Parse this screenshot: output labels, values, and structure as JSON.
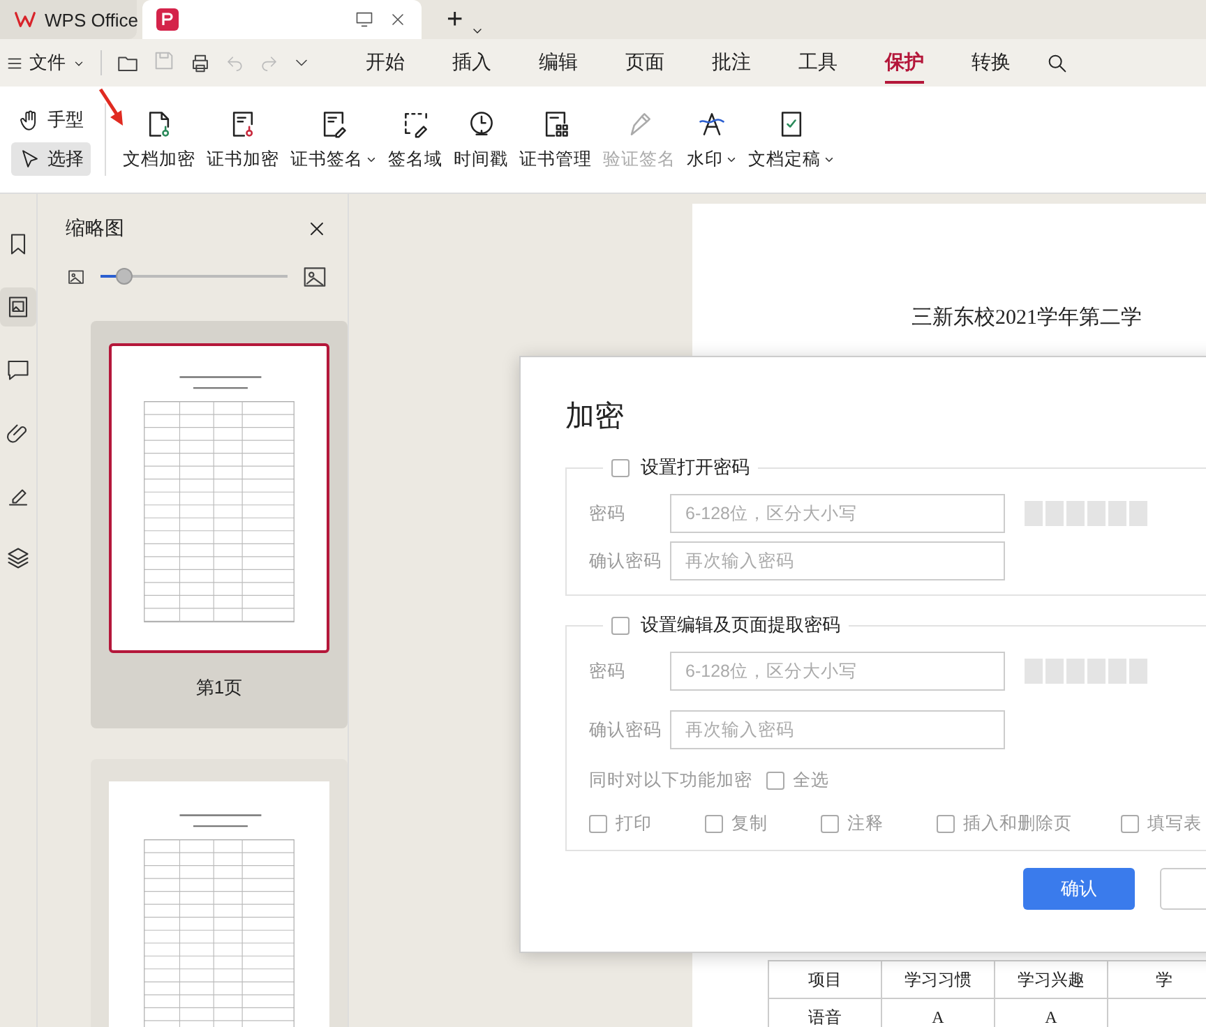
{
  "title_tabs": [
    {
      "kind": "home",
      "title": "WPS Office",
      "selected": false
    },
    {
      "kind": "pdf",
      "selected": true
    }
  ],
  "new_tab": "+",
  "menu": {
    "file": "文件",
    "ribbon_tabs": [
      {
        "label": "开始",
        "selected": false
      },
      {
        "label": "插入",
        "selected": false
      },
      {
        "label": "编辑",
        "selected": false
      },
      {
        "label": "页面",
        "selected": false
      },
      {
        "label": "批注",
        "selected": false
      },
      {
        "label": "工具",
        "selected": false
      },
      {
        "label": "保护",
        "selected": true
      },
      {
        "label": "转换",
        "selected": false
      }
    ]
  },
  "modes": [
    {
      "kind": "hand",
      "label": "手型",
      "selected": false
    },
    {
      "kind": "select",
      "label": "选择",
      "selected": true
    }
  ],
  "tools": [
    {
      "kind": "doc-key",
      "label": "文档加密",
      "dropdown": false,
      "disabled": false
    },
    {
      "kind": "cert-key",
      "label": "证书加密",
      "dropdown": false,
      "disabled": false
    },
    {
      "kind": "cert-sign",
      "label": "证书签名",
      "dropdown": true,
      "disabled": false
    },
    {
      "kind": "sign-field",
      "label": "签名域",
      "dropdown": false,
      "disabled": false
    },
    {
      "kind": "timestamp",
      "label": "时间戳",
      "dropdown": false,
      "disabled": false
    },
    {
      "kind": "cert-manage",
      "label": "证书管理",
      "dropdown": false,
      "disabled": false
    },
    {
      "kind": "verify",
      "label": "验证签名",
      "dropdown": false,
      "disabled": true
    },
    {
      "kind": "watermark",
      "label": "水印",
      "dropdown": true,
      "disabled": false
    },
    {
      "kind": "finalize",
      "label": "文档定稿",
      "dropdown": true,
      "disabled": false
    }
  ],
  "side_rail": [
    {
      "kind": "bookmark",
      "selected": false
    },
    {
      "kind": "thumbnail",
      "selected": true
    },
    {
      "kind": "comment",
      "selected": false
    },
    {
      "kind": "attachment",
      "selected": false
    },
    {
      "kind": "signature",
      "selected": false
    },
    {
      "kind": "layers",
      "selected": false
    }
  ],
  "thumbnails": {
    "title": "缩略图",
    "zoom": {
      "level": 0.13
    },
    "pages": [
      {
        "label": "第1页",
        "selected": true
      },
      {
        "selected": false
      }
    ]
  },
  "document": {
    "heading": "三新东校2021学年第二学",
    "table": {
      "columns": [
        "项目",
        "学习习惯",
        "学习兴趣",
        "学"
      ],
      "rows": [
        [
          "语音",
          "A",
          "A"
        ]
      ]
    }
  },
  "dialog": {
    "title": "加密",
    "sections": [
      {
        "label": "设置打开密码",
        "checked": false,
        "password_label": "密码",
        "password_placeholder": "6-128位，区分大小写",
        "confirm_label": "确认密码",
        "confirm_placeholder": "再次输入密码"
      },
      {
        "label": "设置编辑及页面提取密码",
        "checked": false,
        "password_label": "密码",
        "password_placeholder": "6-128位，区分大小写",
        "confirm_label": "确认密码",
        "confirm_placeholder": "再次输入密码",
        "also_label": "同时对以下功能加密",
        "select_all": {
          "label": "全选",
          "checked": false
        },
        "permissions": [
          {
            "label": "打印",
            "checked": false
          },
          {
            "label": "复制",
            "checked": false
          },
          {
            "label": "注释",
            "checked": false
          },
          {
            "label": "插入和删除页",
            "checked": false
          },
          {
            "label": "填写表",
            "checked": false
          }
        ]
      }
    ],
    "confirm": "确认"
  }
}
